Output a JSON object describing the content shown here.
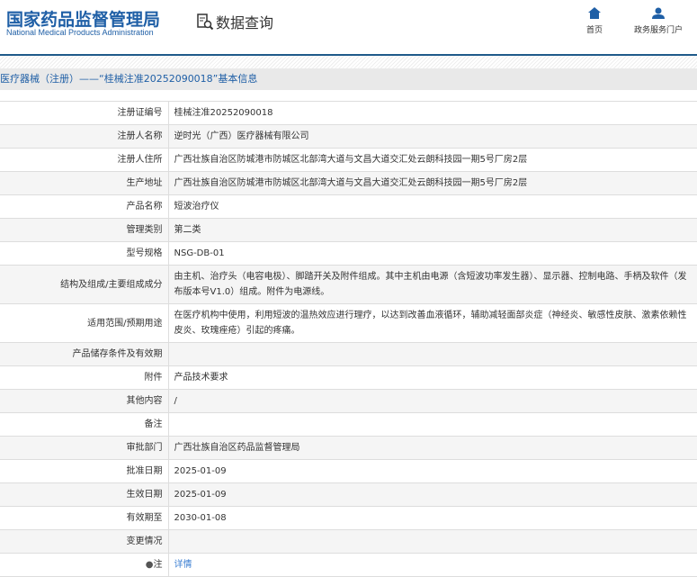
{
  "header": {
    "logo_cn": "国家药品监督管理局",
    "logo_en": "National Medical Products Administration",
    "query_label": "数据查询",
    "nav": [
      {
        "label": "首页",
        "icon": "home-icon"
      },
      {
        "label": "政务服务门户",
        "icon": "user-icon"
      }
    ]
  },
  "title": "医疗器械（注册）——“桂械注准20252090018”基本信息",
  "rows": [
    {
      "label": "注册证编号",
      "value": "桂械注准20252090018"
    },
    {
      "label": "注册人名称",
      "value": "逆时光（广西）医疗器械有限公司"
    },
    {
      "label": "注册人住所",
      "value": "广西壮族自治区防城港市防城区北部湾大道与文昌大道交汇处云朗科技园一期5号厂房2层"
    },
    {
      "label": "生产地址",
      "value": "广西壮族自治区防城港市防城区北部湾大道与文昌大道交汇处云朗科技园一期5号厂房2层"
    },
    {
      "label": "产品名称",
      "value": "短波治疗仪"
    },
    {
      "label": "管理类别",
      "value": "第二类"
    },
    {
      "label": "型号规格",
      "value": "NSG-DB-01"
    },
    {
      "label": "结构及组成/主要组成成分",
      "value": "由主机、治疗头（电容电极）、脚踏开关及附件组成。其中主机由电源（含短波功率发生器）、显示器、控制电路、手柄及软件（发布版本号V1.0）组成。附件为电源线。"
    },
    {
      "label": "适用范围/预期用途",
      "value": "在医疗机构中使用，利用短波的温热效应进行理疗，以达到改善血液循环，辅助减轻面部炎症（神经炎、敏感性皮肤、激素依赖性皮炎、玫瑰痤疮）引起的疼痛。"
    },
    {
      "label": "产品储存条件及有效期",
      "value": ""
    },
    {
      "label": "附件",
      "value": "产品技术要求"
    },
    {
      "label": "其他内容",
      "value": "/"
    },
    {
      "label": "备注",
      "value": ""
    },
    {
      "label": "审批部门",
      "value": "广西壮族自治区药品监督管理局"
    },
    {
      "label": "批准日期",
      "value": "2025-01-09"
    },
    {
      "label": "生效日期",
      "value": "2025-01-09"
    },
    {
      "label": "有效期至",
      "value": "2030-01-08"
    },
    {
      "label": "变更情况",
      "value": ""
    }
  ],
  "note": {
    "label": "注",
    "link": "详情"
  }
}
